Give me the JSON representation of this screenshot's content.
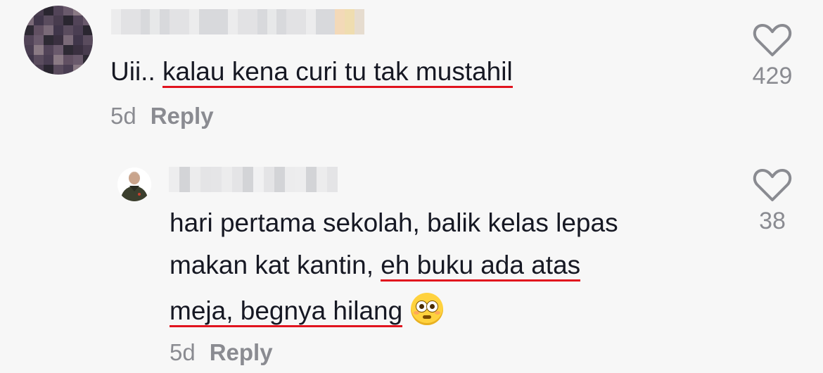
{
  "comment": {
    "prefix": "Uii.. ",
    "highlighted": "kalau kena curi tu tak mustahil",
    "age": "5d",
    "reply_label": "Reply",
    "likes": "429"
  },
  "reply_comment": {
    "line1": "hari pertama sekolah, balik kelas lepas",
    "line2_plain": "makan kat kantin, ",
    "line2_highlighted": "eh buku ada atas",
    "line3_highlighted": "meja, begnya hilang",
    "emoji_name": "flushed-face-emoji",
    "age": "5d",
    "reply_label": "Reply",
    "likes": "38"
  },
  "colors": {
    "background": "#f7f7f7",
    "text": "#161823",
    "secondary": "#8a8b91",
    "underline": "#e1141e"
  }
}
